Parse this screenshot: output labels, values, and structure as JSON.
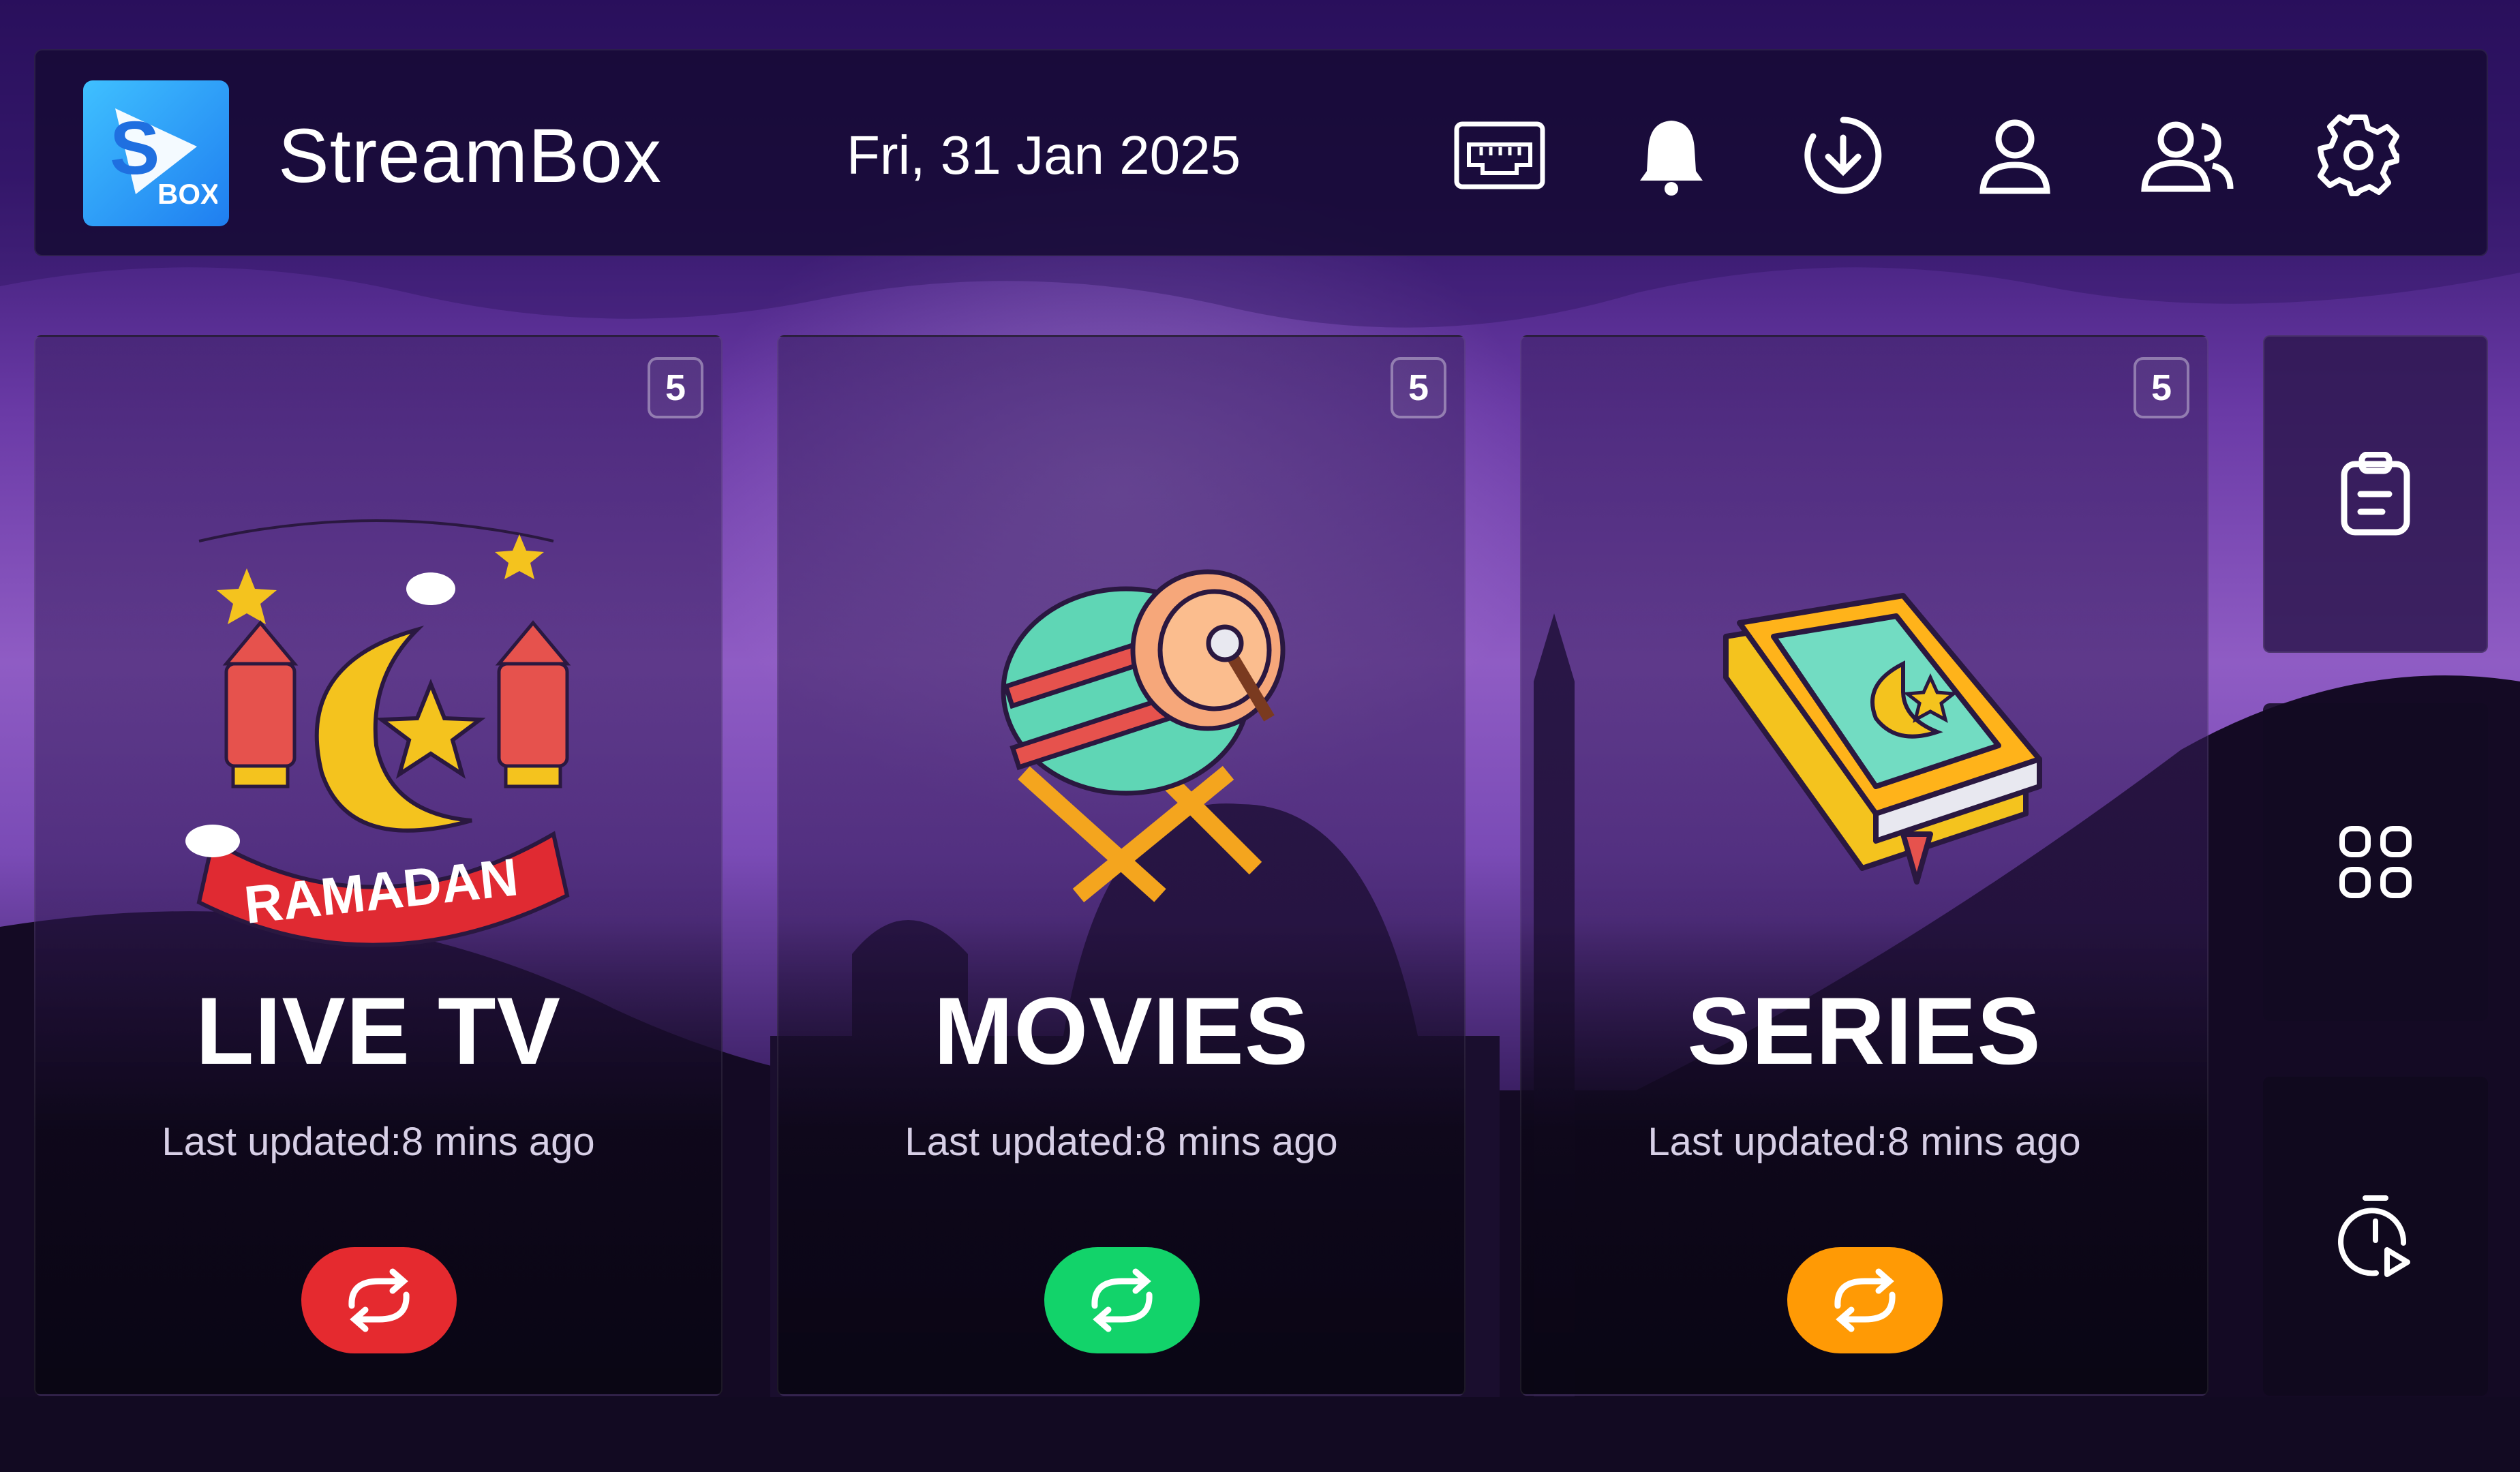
{
  "header": {
    "app_name": "StreamBox",
    "logo_text": "BOX",
    "date": "Fri, 31 Jan 2025",
    "icons": [
      "ethernet-icon",
      "bell-icon",
      "download-icon",
      "user-icon",
      "users-icon",
      "gear-icon"
    ]
  },
  "cards": [
    {
      "title": "LIVE TV",
      "updated": "Last updated:8 mins ago",
      "count": "5",
      "art_text": "RAMADAN",
      "button_color": "#e52a2f"
    },
    {
      "title": "MOVIES",
      "updated": "Last updated:8 mins ago",
      "count": "5",
      "button_color": "#12d36a"
    },
    {
      "title": "SERIES",
      "updated": "Last updated:8 mins ago",
      "count": "5",
      "button_color": "#ff9a05"
    }
  ],
  "side": [
    "clipboard-icon",
    "apps-grid-icon",
    "timer-play-icon"
  ]
}
